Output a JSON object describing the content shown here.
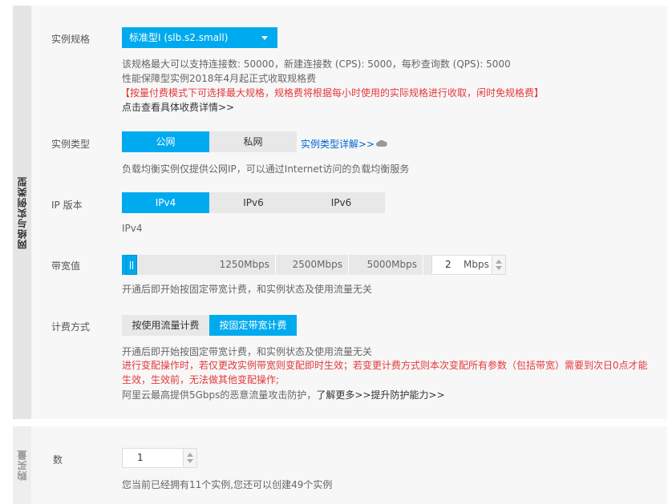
{
  "section1": {
    "sidebar_title": "网络与实例类型",
    "spec": {
      "label": "实例规格",
      "selected": "标准型I (slb.s2.small)",
      "desc1": "该规格最大可以支持连接数: 50000，新建连接数 (CPS): 5000，每秒查询数 (QPS): 5000",
      "desc2": "性能保障型实例2018年4月起正式收取规格费",
      "warning": "【按量付费模式下可选择最大规格，规格费将根据每小时使用的实际规格进行收取，闲时免规格费】",
      "detail_link": "点击查看具体收费详情>>"
    },
    "instance_type": {
      "label": "实例类型",
      "options": [
        "公网",
        "私网"
      ],
      "selected": "公网",
      "detail_link": "实例类型详解>>",
      "desc": "负载均衡实例仅提供公网IP，可以通过Internet访问的负载均衡服务"
    },
    "ip_version": {
      "label": "IP 版本",
      "options": [
        "IPv4",
        "IPv6",
        "IPv6"
      ],
      "selected": "IPv4",
      "value_text": "IPv4"
    },
    "bandwidth": {
      "label": "带宽值",
      "ticks": [
        "1250Mbps",
        "2500Mbps",
        "5000Mbps"
      ],
      "value": "2",
      "unit": "Mbps",
      "desc": "开通后即开始按固定带宽计费，和实例状态及使用流量无关"
    },
    "billing": {
      "label": "计费方式",
      "options": [
        "按使用流量计费",
        "按固定带宽计费"
      ],
      "selected": "按固定带宽计费",
      "desc": "开通后即开始按固定带宽计费，和实例状态及使用流量无关",
      "warning_line1": "进行变配操作时，若仅更改实例带宽则变配即时生效；若变更计费方式则本次变配所有参数（包括带宽）需要到次日0点才能",
      "warning_line2": "生效，生效前，无法做其他变配操作;",
      "protect_text": "阿里云最高提供5Gbps的恶意流量攻击防护，",
      "learn_more": "了解更多>>",
      "upgrade": "提升防护能力>>"
    }
  },
  "section2": {
    "sidebar_title": "购买量",
    "quantity": {
      "label": "数",
      "value": "1",
      "desc": "您当前已经拥有11个实例,您还可以创建49个实例"
    }
  },
  "colors": {
    "accent": "#00aaee",
    "warning": "#e4393c",
    "link": "#0066cc"
  }
}
